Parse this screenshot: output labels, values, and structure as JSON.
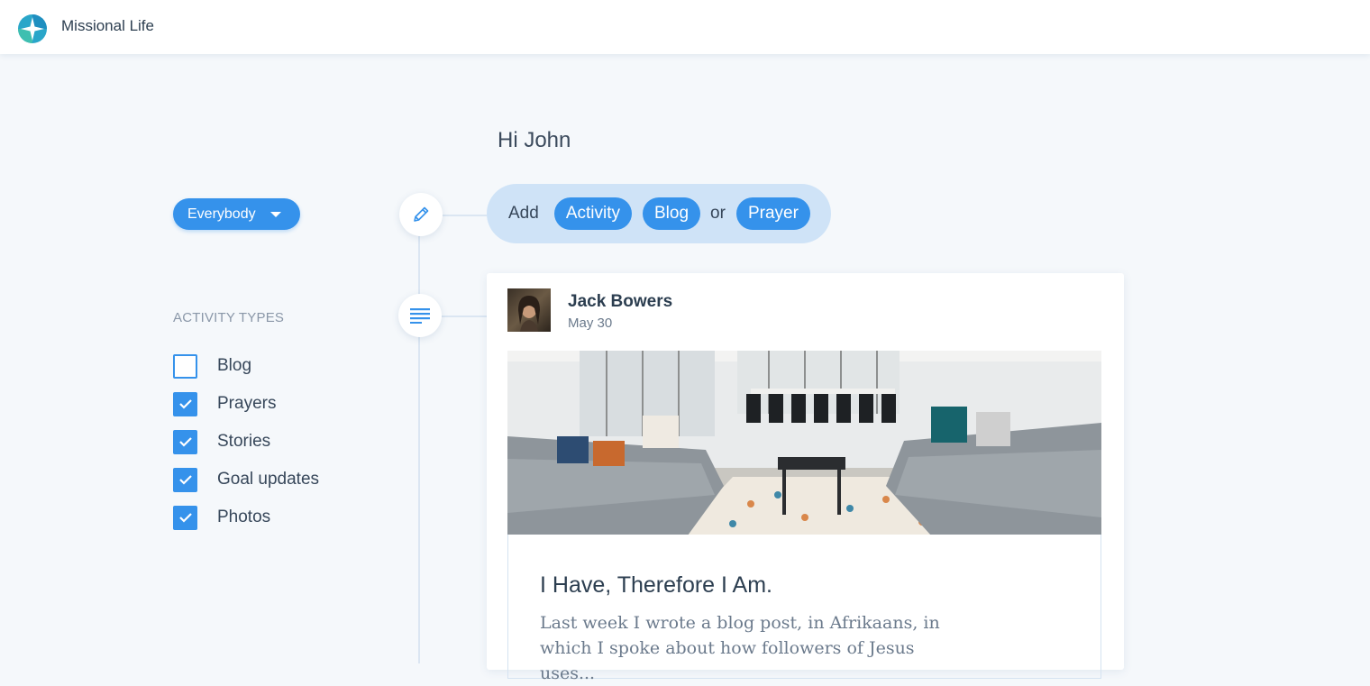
{
  "app": {
    "title": "Missional Life"
  },
  "greeting": "Hi John",
  "audience_filter": {
    "selected": "Everybody"
  },
  "add_bar": {
    "prefix": "Add",
    "or_word": "or",
    "actions": [
      "Activity",
      "Blog",
      "Prayer"
    ]
  },
  "filters": {
    "heading": "ACTIVITY TYPES",
    "items": [
      {
        "label": "Blog",
        "checked": false
      },
      {
        "label": "Prayers",
        "checked": true
      },
      {
        "label": "Stories",
        "checked": true
      },
      {
        "label": "Goal updates",
        "checked": true
      },
      {
        "label": "Photos",
        "checked": true
      }
    ]
  },
  "post": {
    "author": "Jack Bowers",
    "date": "May 30",
    "title": "I Have, Therefore I Am.",
    "excerpt": "Last week I wrote a blog post, in Afrikaans, in which I spoke about how followers of Jesus uses..."
  },
  "colors": {
    "accent": "#3592eb",
    "add_bar_bg": "#cfe3f7",
    "page_bg": "#f5f8fb"
  },
  "icons": {
    "compose": "pencil-icon",
    "post_type": "text-lines-icon"
  }
}
